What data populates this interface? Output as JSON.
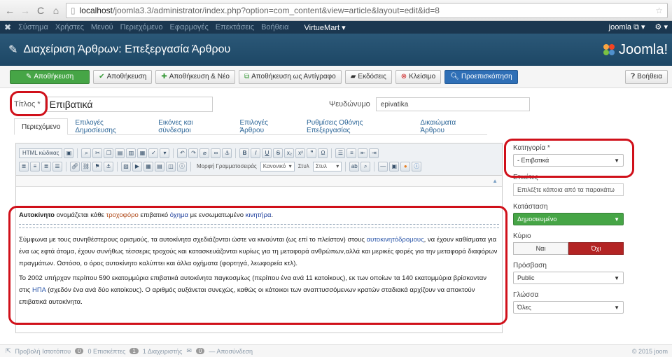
{
  "browser": {
    "url_host": "localhost",
    "url_path": "/joomla3.3/administrator/index.php?option=com_content&view=article&layout=edit&id=8"
  },
  "topmenu": {
    "items": [
      "Σύστημα",
      "Χρήστες",
      "Μενού",
      "Περιεχόμενο",
      "Εφαρμογές",
      "Επεκτάσεις",
      "Βοήθεια"
    ],
    "virtuemart": "VirtueMart ▾",
    "user": "joomla ⧉ ▾",
    "settings": "⚙ ▾"
  },
  "header": {
    "title": "Διαχείριση Άρθρων: Επεξεργασία Άρθρου",
    "brand": "Joomla!"
  },
  "toolbar": {
    "save": "Αποθήκευση",
    "save_close": "Αποθήκευση",
    "save_new": "Αποθήκευση & Νέο",
    "save_copy": "Αποθήκευση ως Αντίγραφο",
    "versions": "Εκδόσεις",
    "close": "Κλείσιμο",
    "preview": "Προεπισκόπηση",
    "help": "Βοήθεια"
  },
  "form": {
    "title_label": "Τίτλος *",
    "title_value": "Επιβατικά",
    "alias_label": "Ψευδώνυμο",
    "alias_value": "epivatika"
  },
  "tabs": [
    "Περιεχόμενο",
    "Επιλογές Δημοσίευσης",
    "Εικόνες και σύνδεσμοι",
    "Επιλογές Άρθρου",
    "Ρυθμίσεις Οθόνης Επεξεργασίας",
    "Δικαιώματα Άρθρου"
  ],
  "editor": {
    "html_button": "HTML κώδικας",
    "font_format_label": "Μορφή Γραμματοσειράς",
    "font_format_value": "Κανονικό",
    "style_label": "Στυλ",
    "style_value": "Στυλ",
    "p1_bold": "Αυτοκίνητο",
    "p1_a": " ονομάζεται κάθε ",
    "p1_link1": "τροχοφόρο",
    "p1_b": " επιβατικό ",
    "p1_link2": "όχημα",
    "p1_c": " με ενσωματωμένο ",
    "p1_link3": "κινητήρα",
    "p1_d": ".",
    "p2_a": " Σύμφωνα με τους συνηθέστερους ορισμούς, τα αυτοκίνητα σχεδιάζονται ώστε να κινούνται (ως επί το πλείστον) στους ",
    "p2_link": "αυτοκινητόδρομους",
    "p2_b": ", να έχουν καθίσματα για ένα ως εφτά άτομα, έχουν συνήθως τέσσερις τροχούς και κατασκευάζονται κυρίως για τη μεταφορά ανθρώπων,αλλά και μερικές φορές για την μεταφορά διαφόρων πραγμάτων. Ωστόσο, ο όρος αυτοκίνητο καλύπτει και άλλα οχήματα (φορτηγά, λεωφορεία κτλ).",
    "p3_a": "Το 2002 υπήρχαν περίπου 590 εκατομμύρια επιβατικά αυτοκίνητα παγκοσμίως (περίπου ένα ανά 11 κατοίκους), εκ των οποίων τα 140 εκατομμύρια βρίσκονταν στις ",
    "p3_link": "ΗΠΑ",
    "p3_b": " (σχεδόν ένα ανά δύο κατοίκους). Ο αριθμός αυξάνεται συνεχώς, καθώς οι κάτοικοι των αναπτυσσόμενων κρατών σταδιακά αρχίζουν να αποκτούν επιβατικά αυτοκίνητα."
  },
  "side": {
    "category_label": "Κατηγορία *",
    "category_value": "- Επιβατικά",
    "tags_label": "Ετικέτες",
    "tags_placeholder": "Επιλέξτε κάποια από τα παρακάτω",
    "status_label": "Κατάσταση",
    "status_value": "Δημοσιευμένο",
    "featured_label": "Κύριο",
    "featured_yes": "Ναι",
    "featured_no": "Όχι",
    "access_label": "Πρόσβαση",
    "access_value": "Public",
    "language_label": "Γλώσσα",
    "language_value": "Όλες"
  },
  "statusbar": {
    "view_site": "Προβολή Ιστοτόπου",
    "visitors_count": "0",
    "visitors_label": "0 Επισκέπτες",
    "admins_count": "1",
    "admins_label": "1 Διαχειριστής",
    "messages_count": "0",
    "logout": "— Αποσύνδεση",
    "copyright": "© 2015 joom"
  },
  "colors": {
    "annotation": "#d0101a",
    "header_bg": "#1d4765",
    "green": "#46a546",
    "danger": "#b32424"
  }
}
